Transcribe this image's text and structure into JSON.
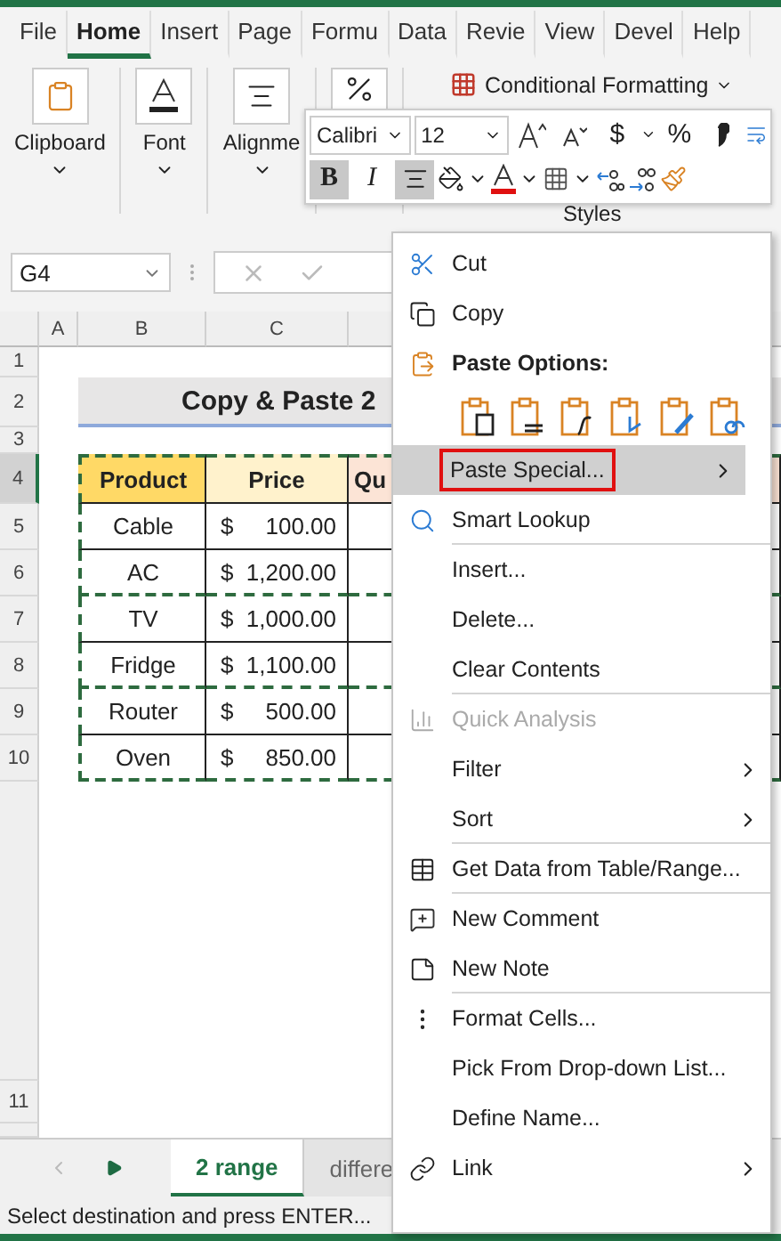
{
  "ribbon": {
    "tabs": [
      {
        "label": "File",
        "selected": false
      },
      {
        "label": "Home",
        "selected": true
      },
      {
        "label": "Insert",
        "selected": false
      },
      {
        "label": "Page",
        "selected": false
      },
      {
        "label": "Formu",
        "selected": false
      },
      {
        "label": "Data",
        "selected": false
      },
      {
        "label": "Revie",
        "selected": false
      },
      {
        "label": "View",
        "selected": false
      },
      {
        "label": "Devel",
        "selected": false
      },
      {
        "label": "Help",
        "selected": false
      }
    ],
    "groups": [
      {
        "kind": "clipboard",
        "label": "Clipboard"
      },
      {
        "kind": "font",
        "label": "Font"
      },
      {
        "kind": "alignment",
        "label": "Alignme"
      },
      {
        "kind": "number"
      }
    ],
    "styles": {
      "button": "Conditional Formatting",
      "label": "Styles"
    }
  },
  "mini_toolbar": {
    "font": "Calibri",
    "size": "12",
    "row_1": [
      {
        "kind": "grow"
      },
      {
        "kind": "shrink"
      },
      {
        "kind": "currency",
        "label": "$"
      },
      {
        "kind": "caret"
      },
      {
        "kind": "percent",
        "label": "%"
      },
      {
        "kind": "comma"
      },
      {
        "kind": "wrap"
      }
    ],
    "row_2": [
      {
        "kind": "bold",
        "label": "B",
        "selected": true
      },
      {
        "kind": "italic",
        "label": "I",
        "selected": false
      },
      {
        "kind": "align",
        "selected": true
      },
      {
        "kind": "fill"
      },
      {
        "kind": "caret"
      },
      {
        "kind": "font-color"
      },
      {
        "kind": "caret"
      },
      {
        "kind": "borders"
      },
      {
        "kind": "caret"
      },
      {
        "kind": "increase-decimal"
      },
      {
        "kind": "decrease-decimal"
      },
      {
        "kind": "painter"
      }
    ]
  },
  "formula_bar": {
    "name_box": "G4"
  },
  "sheet": {
    "columns": [
      "A",
      "B",
      "C"
    ],
    "row_numbers": [
      "1",
      "2",
      "3",
      "4",
      "5",
      "6",
      "7",
      "8",
      "9",
      "10",
      "11"
    ],
    "title": "Copy & Paste 2",
    "header": [
      "Product",
      "Price",
      "Qu"
    ],
    "rows": [
      {
        "product": "Cable",
        "currency": "$",
        "price": "100.00",
        "range_end": false
      },
      {
        "product": "AC",
        "currency": "$",
        "price": "1,200.00",
        "range_end": true
      },
      {
        "product": "TV",
        "currency": "$",
        "price": "1,000.00",
        "range_end": false
      },
      {
        "product": "Fridge",
        "currency": "$",
        "price": "1,100.00",
        "range_end": true
      },
      {
        "product": "Router",
        "currency": "$",
        "price": "500.00",
        "range_end": false
      },
      {
        "product": "Oven",
        "currency": "$",
        "price": "850.00",
        "range_end": true
      }
    ]
  },
  "sheet_tabs": [
    {
      "label": "2 range",
      "selected": true
    },
    {
      "label": "differe",
      "selected": false
    }
  ],
  "status_bar": "Select destination and press ENTER...",
  "context_menu": {
    "items": [
      {
        "kind": "cut",
        "label": "Cut",
        "selected": false,
        "disabled": false,
        "submenu": false,
        "divider_after": false
      },
      {
        "kind": "copy",
        "label": "Copy",
        "selected": false,
        "disabled": false,
        "submenu": false,
        "divider_after": false
      },
      {
        "kind": "paste-header",
        "label": "Paste Options:",
        "selected": false,
        "disabled": false,
        "submenu": false,
        "divider_after": false
      },
      {
        "kind": "paste-icons"
      },
      {
        "kind": "plain",
        "label": "Paste Special...",
        "selected": true,
        "disabled": false,
        "submenu": true,
        "divider_after": false
      },
      {
        "kind": "lookup",
        "label": "Smart Lookup",
        "selected": false,
        "disabled": false,
        "submenu": false,
        "divider_after": true
      },
      {
        "kind": "plain",
        "label": "Insert...",
        "selected": false,
        "disabled": false,
        "submenu": false,
        "divider_after": false
      },
      {
        "kind": "plain",
        "label": "Delete...",
        "selected": false,
        "disabled": false,
        "submenu": false,
        "divider_after": false
      },
      {
        "kind": "plain",
        "label": "Clear Contents",
        "selected": false,
        "disabled": false,
        "submenu": false,
        "divider_after": true
      },
      {
        "kind": "quick-analysis",
        "label": "Quick Analysis",
        "selected": false,
        "disabled": true,
        "submenu": false,
        "divider_after": false
      },
      {
        "kind": "plain",
        "label": "Filter",
        "selected": false,
        "disabled": false,
        "submenu": true,
        "divider_after": false
      },
      {
        "kind": "plain",
        "label": "Sort",
        "selected": false,
        "disabled": false,
        "submenu": true,
        "divider_after": true
      },
      {
        "kind": "table",
        "label": "Get Data from Table/Range...",
        "selected": false,
        "disabled": false,
        "submenu": false,
        "divider_after": true
      },
      {
        "kind": "comment",
        "label": "New Comment",
        "selected": false,
        "disabled": false,
        "submenu": false,
        "divider_after": false
      },
      {
        "kind": "note",
        "label": "New Note",
        "selected": false,
        "disabled": false,
        "submenu": false,
        "divider_after": true
      },
      {
        "kind": "format",
        "label": "Format Cells...",
        "selected": false,
        "disabled": false,
        "submenu": false,
        "divider_after": false
      },
      {
        "kind": "plain",
        "label": "Pick From Drop-down List...",
        "selected": false,
        "disabled": false,
        "submenu": false,
        "divider_after": false
      },
      {
        "kind": "plain",
        "label": "Define Name...",
        "selected": false,
        "disabled": false,
        "submenu": false,
        "divider_after": false
      },
      {
        "kind": "link",
        "label": "Link",
        "selected": false,
        "disabled": false,
        "submenu": true,
        "divider_after": false
      }
    ]
  }
}
